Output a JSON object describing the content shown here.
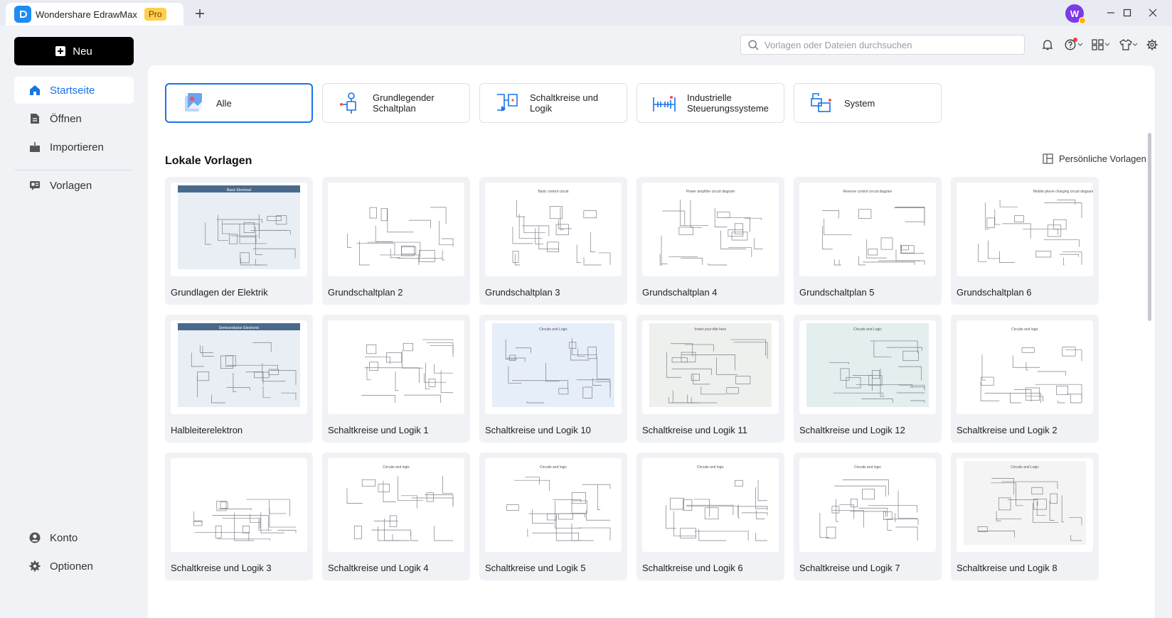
{
  "titlebar": {
    "app_name": "Wondershare EdrawMax",
    "badge": "Pro",
    "new_tab": "+",
    "avatar_initial": "W"
  },
  "sidebar": {
    "new_button": "Neu",
    "items": [
      {
        "label": "Startseite",
        "icon": "home-icon"
      },
      {
        "label": "Öffnen",
        "icon": "file-icon"
      },
      {
        "label": "Importieren",
        "icon": "import-icon"
      },
      {
        "label": "Vorlagen",
        "icon": "templates-icon"
      }
    ],
    "bottom_items": [
      {
        "label": "Konto",
        "icon": "account-icon"
      },
      {
        "label": "Optionen",
        "icon": "settings-icon"
      }
    ]
  },
  "search": {
    "placeholder": "Vorlagen oder Dateien durchsuchen"
  },
  "categories": [
    {
      "label": "Alle"
    },
    {
      "label": "Grundlegender Schaltplan"
    },
    {
      "label": "Schaltkreise und Logik"
    },
    {
      "label": "Industrielle Steuerungssysteme"
    },
    {
      "label": "System"
    }
  ],
  "section": {
    "title": "Lokale Vorlagen",
    "personal_link": "Persönliche Vorlagen"
  },
  "templates": [
    {
      "label": "Grundlagen der Elektrik",
      "thumb_title": "Basic Electrical"
    },
    {
      "label": "Grundschaltplan 2",
      "thumb_title": ""
    },
    {
      "label": "Grundschaltplan 3",
      "thumb_title": "Basic control circuit"
    },
    {
      "label": "Grundschaltplan 4",
      "thumb_title": "Power amplifier circuit diagram"
    },
    {
      "label": "Grundschaltplan 5",
      "thumb_title": "Reverse control circuit diagram"
    },
    {
      "label": "Grundschaltplan 6",
      "thumb_title": "Mobile phone charging circuit diagram"
    },
    {
      "label": "Halbleiterelektron",
      "thumb_title": "Semiconductor Electronic"
    },
    {
      "label": "Schaltkreise und Logik 1",
      "thumb_title": ""
    },
    {
      "label": "Schaltkreise und Logik 10",
      "thumb_title": "Circuits and Logic"
    },
    {
      "label": "Schaltkreise und Logik 11",
      "thumb_title": "Insert your title here"
    },
    {
      "label": "Schaltkreise und Logik 12",
      "thumb_title": "Circuits and Logic"
    },
    {
      "label": "Schaltkreise und Logik 2",
      "thumb_title": "Circuits and logic"
    },
    {
      "label": "Schaltkreise und Logik 3",
      "thumb_title": ""
    },
    {
      "label": "Schaltkreise und Logik 4",
      "thumb_title": "Circuits and logic"
    },
    {
      "label": "Schaltkreise und Logik 5",
      "thumb_title": "Circuits and logic"
    },
    {
      "label": "Schaltkreise und Logik 6",
      "thumb_title": "Circuits and logic"
    },
    {
      "label": "Schaltkreise und Logik 7",
      "thumb_title": "Circuits and logic"
    },
    {
      "label": "Schaltkreise und Logik 8",
      "thumb_title": "Circuits and Logic"
    }
  ],
  "colors": {
    "accent": "#1a73e8",
    "sidebar_bg": "#f1f2f6",
    "new_button_bg": "#000000",
    "pro_badge": "#ffcf4d"
  }
}
